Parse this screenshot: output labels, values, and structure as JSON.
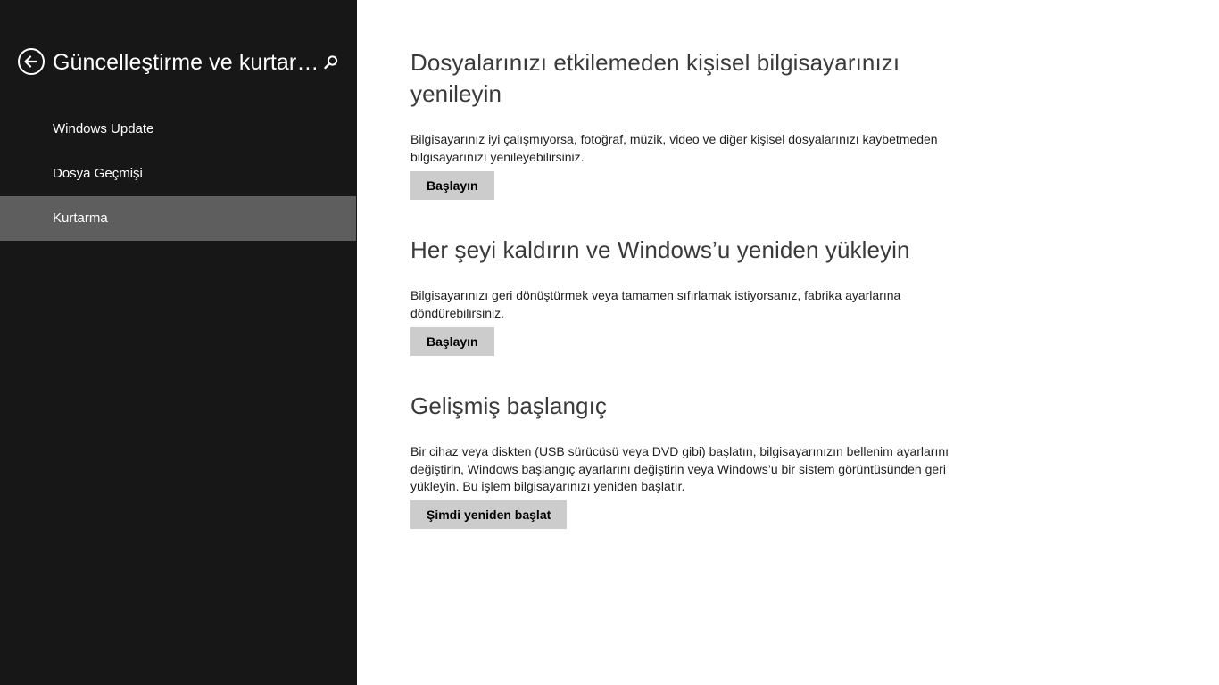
{
  "sidebar": {
    "title": "Güncelleştirme ve kurtarma",
    "back_icon": "back-arrow-icon",
    "search_icon": "search-icon",
    "items": [
      {
        "label": "Windows Update",
        "active": false
      },
      {
        "label": "Dosya Geçmişi",
        "active": false
      },
      {
        "label": "Kurtarma",
        "active": true
      }
    ]
  },
  "main": {
    "sections": [
      {
        "title": "Dosyalarınızı etkilemeden kişisel bilgisayarınızı yenileyin",
        "description": "Bilgisayarınız iyi çalışmıyorsa, fotoğraf, müzik, video ve diğer kişisel dosyalarınızı kaybetmeden bilgisayarınızı yenileyebilirsiniz.",
        "button": "Başlayın"
      },
      {
        "title": "Her şeyi kaldırın ve Windows’u yeniden yükleyin",
        "description": "Bilgisayarınızı geri dönüştürmek veya tamamen sıfırlamak istiyorsanız, fabrika ayarlarına döndürebilirsiniz.",
        "button": "Başlayın"
      },
      {
        "title": "Gelişmiş başlangıç",
        "description": "Bir cihaz veya diskten (USB sürücüsü veya DVD gibi) başlatın, bilgisayarınızın bellenim ayarlarını değiştirin, Windows başlangıç ayarlarını değiştirin veya Windows’u bir sistem görüntüsünden geri yükleyin. Bu işlem bilgisayarınızı yeniden başlatır.",
        "button": "Şimdi yeniden başlat"
      }
    ]
  },
  "colors": {
    "sidebar_bg": "#171717",
    "sidebar_active": "#5e5e5e",
    "main_bg": "#ffffff",
    "button_bg": "#cccccc"
  }
}
